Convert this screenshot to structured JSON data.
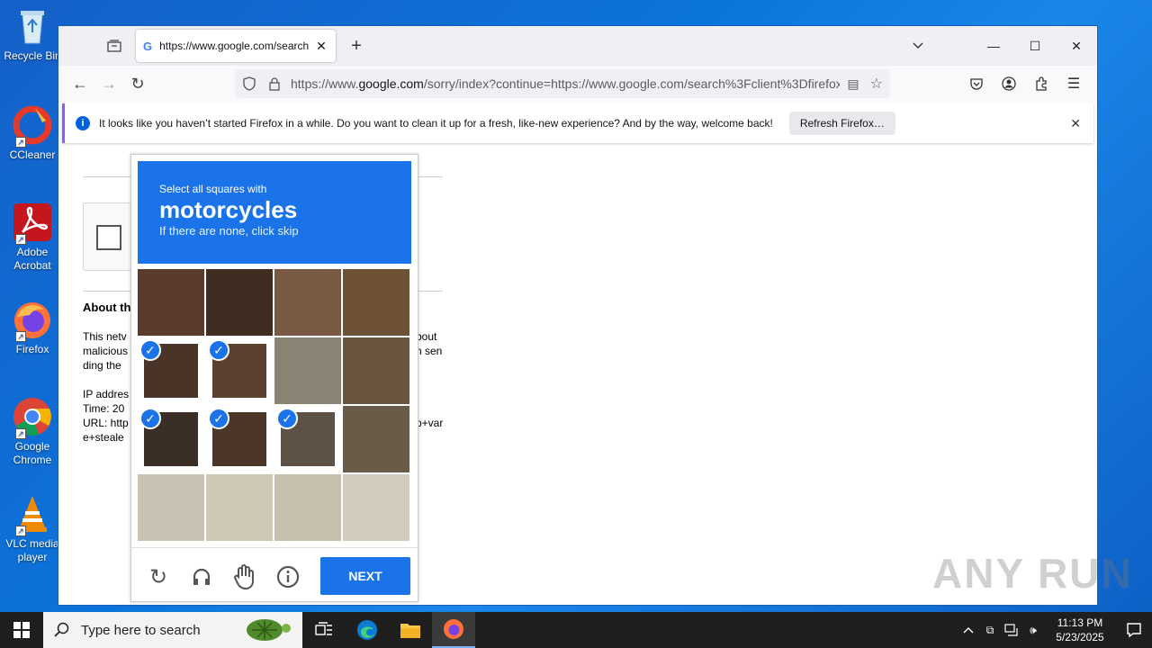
{
  "desktop": {
    "icons": [
      {
        "label": "Recycle Bin"
      },
      {
        "label": "CCleaner"
      },
      {
        "label": "Adobe Acrobat"
      },
      {
        "label": "Firefox"
      },
      {
        "label": "Google Chrome"
      },
      {
        "label": "VLC media player"
      }
    ]
  },
  "browser": {
    "tab": {
      "title": "https://www.google.com/search"
    },
    "url": {
      "prefix": "https://www.",
      "domain": "google.com",
      "rest": "/sorry/index?continue=https://www.google.com/search%3Fclient%3Dfirefox"
    },
    "notification": {
      "message": "It looks like you haven’t started Firefox in a while. Do you want to clean it up for a fresh, like-new experience? And by the way, welcome back!",
      "button": "Refresh Firefox…"
    }
  },
  "page": {
    "about_heading": "About th",
    "text_lines": [
      "This netv",
      "malicious",
      "ding the",
      "IP addres",
      "Time: 20",
      "URL: http",
      "e+steale"
    ],
    "right_fragments": [
      "bout",
      "n sen",
      "p+var"
    ]
  },
  "challenge": {
    "line1": "Select all squares with",
    "target": "motorcycles",
    "line3": "If there are none, click skip",
    "next_label": "NEXT",
    "tiles": [
      {
        "selected": false
      },
      {
        "selected": false
      },
      {
        "selected": false
      },
      {
        "selected": false
      },
      {
        "selected": true
      },
      {
        "selected": true
      },
      {
        "selected": false
      },
      {
        "selected": false
      },
      {
        "selected": true
      },
      {
        "selected": true
      },
      {
        "selected": true
      },
      {
        "selected": false
      },
      {
        "selected": false
      },
      {
        "selected": false
      },
      {
        "selected": false
      },
      {
        "selected": false
      }
    ]
  },
  "watermark": "ANY RUN",
  "taskbar": {
    "search_placeholder": "Type here to search",
    "time": "11:13 PM",
    "date": "5/23/2025"
  },
  "colors": {
    "accent": "#1a73e8",
    "desktop": "#0b74da",
    "taskbar": "#1f1f1f"
  }
}
